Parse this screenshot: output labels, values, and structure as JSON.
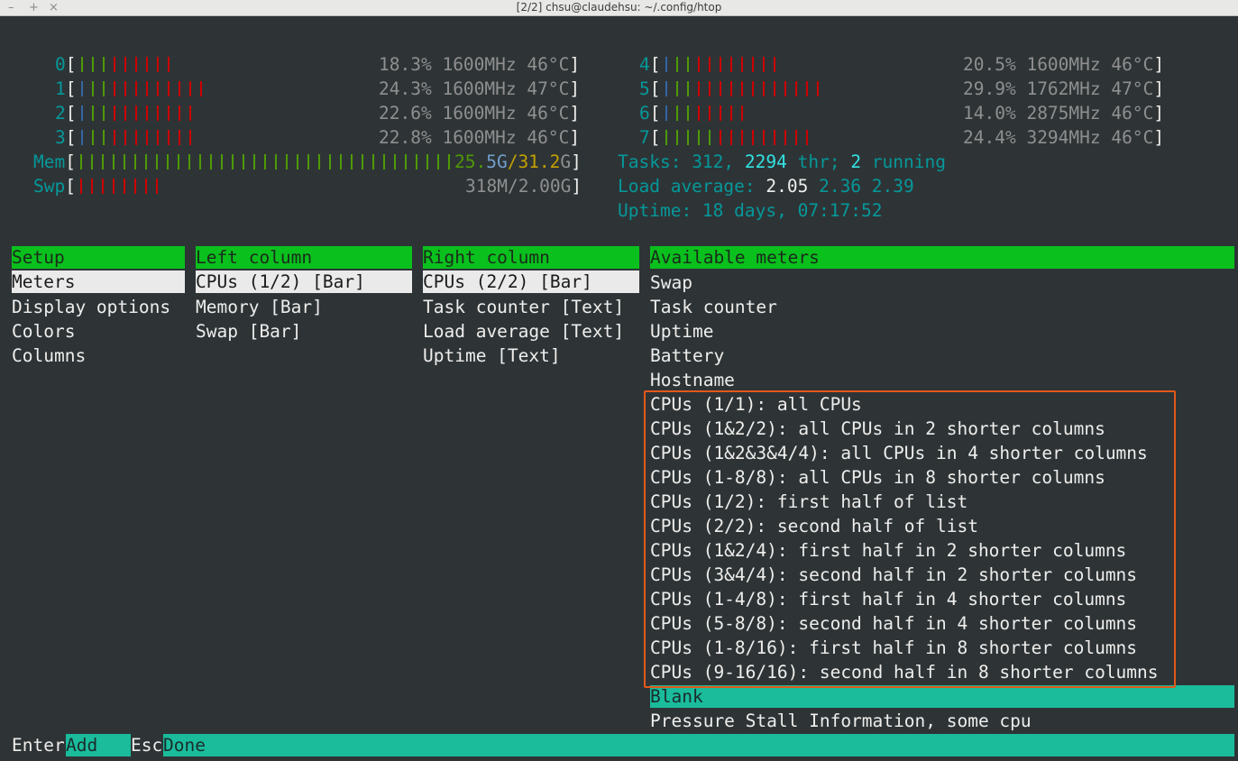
{
  "window": {
    "title": "[2/2] chsu@claudehsu: ~/.config/htop",
    "controls": [
      "–",
      "+",
      "×"
    ]
  },
  "cpus": [
    {
      "id": "0",
      "pct": "18.3%",
      "mhz": "1600MHz",
      "temp": "46°C",
      "bars": {
        "blue": 0,
        "green": 3,
        "red": 6
      }
    },
    {
      "id": "1",
      "pct": "24.3%",
      "mhz": "1600MHz",
      "temp": "47°C",
      "bars": {
        "blue": 1,
        "green": 2,
        "red": 9
      }
    },
    {
      "id": "2",
      "pct": "22.6%",
      "mhz": "1600MHz",
      "temp": "46°C",
      "bars": {
        "blue": 1,
        "green": 2,
        "red": 8
      }
    },
    {
      "id": "3",
      "pct": "22.8%",
      "mhz": "1600MHz",
      "temp": "46°C",
      "bars": {
        "blue": 1,
        "green": 2,
        "red": 8
      }
    },
    {
      "id": "4",
      "pct": "20.5%",
      "mhz": "1600MHz",
      "temp": "46°C",
      "bars": {
        "blue": 1,
        "green": 2,
        "red": 8
      }
    },
    {
      "id": "5",
      "pct": "29.9%",
      "mhz": "1762MHz",
      "temp": "47°C",
      "bars": {
        "blue": 1,
        "green": 2,
        "red": 12
      }
    },
    {
      "id": "6",
      "pct": "14.0%",
      "mhz": "2875MHz",
      "temp": "46°C",
      "bars": {
        "blue": 1,
        "green": 2,
        "red": 5
      }
    },
    {
      "id": "7",
      "pct": "24.4%",
      "mhz": "3294MHz",
      "temp": "46°C",
      "bars": {
        "blue": 0,
        "green": 5,
        "red": 9
      }
    }
  ],
  "mem": {
    "label": "Mem",
    "used": "25.5",
    "used_suffix": "G",
    "sep": "/",
    "total": "31.2",
    "total_suffix": "G",
    "bars": 35
  },
  "swp": {
    "label": "Swp",
    "value": "318M/2.00G",
    "bars": 8
  },
  "tasks": {
    "label": "Tasks: ",
    "count": "312",
    "sep1": ", ",
    "thr": "2294",
    "thr_label": " thr; ",
    "running": "2",
    "running_label": " running"
  },
  "load": {
    "label": "Load average: ",
    "v1": "2.05",
    "v2": "2.36",
    "v3": "2.39"
  },
  "uptime": {
    "label": "Uptime: ",
    "value": "18 days, 07:17:52"
  },
  "setup": {
    "header": "Setup",
    "items": [
      "Meters",
      "Display options",
      "Colors",
      "Columns"
    ]
  },
  "left_column": {
    "header": "Left column",
    "items": [
      "CPUs (1/2) [Bar]",
      "Memory [Bar]",
      "Swap [Bar]"
    ]
  },
  "right_column": {
    "header": "Right column",
    "items": [
      "CPUs (2/2) [Bar]",
      "Task counter [Text]",
      "Load average [Text]",
      "Uptime [Text]"
    ]
  },
  "available": {
    "header": "Available meters",
    "items": [
      "Swap",
      "Task counter",
      "Uptime",
      "Battery",
      "Hostname",
      "CPUs (1/1): all CPUs",
      "CPUs (1&2/2): all CPUs in 2 shorter columns",
      "CPUs (1&2&3&4/4): all CPUs in 4 shorter columns",
      "CPUs (1-8/8): all CPUs in 8 shorter columns",
      "CPUs (1/2): first half of list",
      "CPUs (2/2): second half of list",
      "CPUs (1&2/4): first half in 2 shorter columns",
      "CPUs (3&4/4): second half in 2 shorter columns",
      "CPUs (1-4/8): first half in 4 shorter columns",
      "CPUs (5-8/8): second half in 4 shorter columns",
      "CPUs (1-8/16): first half in 8 shorter columns",
      "CPUs (9-16/16): second half in 8 shorter columns",
      "Blank",
      "Pressure Stall Information, some cpu"
    ]
  },
  "footer": {
    "keys": [
      {
        "key": "Enter",
        "label": "Add"
      },
      {
        "key": "Esc",
        "label": "Done"
      }
    ]
  },
  "colors": {
    "highlight_box": "#e2581a",
    "header_green": "#0ac01d",
    "footer_teal": "#1abc9c"
  }
}
